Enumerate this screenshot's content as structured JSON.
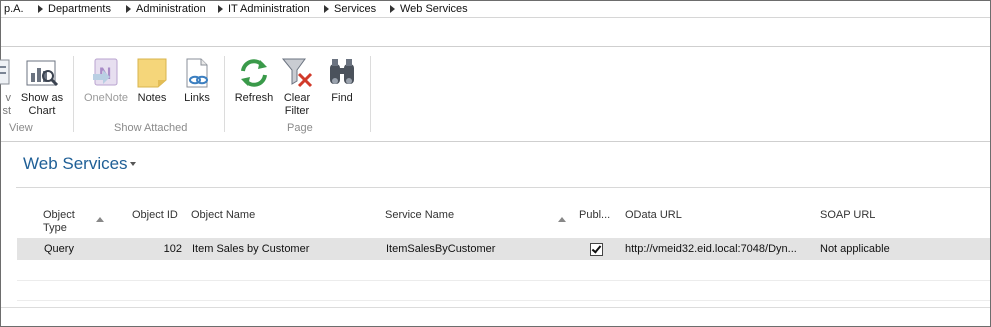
{
  "breadcrumb": {
    "items": [
      "p.A.",
      "Departments",
      "Administration",
      "IT Administration",
      "Services",
      "Web Services"
    ]
  },
  "ribbon": {
    "view_group": {
      "partial_label": "v\nst",
      "chart_label": "Show as\nChart",
      "group_label": "View"
    },
    "attached_group": {
      "onenote_label": "OneNote",
      "notes_label": "Notes",
      "links_label": "Links",
      "group_label": "Show Attached"
    },
    "page_group": {
      "refresh_label": "Refresh",
      "clear_filter_label": "Clear\nFilter",
      "find_label": "Find",
      "group_label": "Page"
    }
  },
  "page": {
    "title": "Web Services"
  },
  "table": {
    "columns": {
      "object_type": "Object\nType",
      "object_id": "Object ID",
      "object_name": "Object Name",
      "service_name": "Service Name",
      "published": "Publ...",
      "odata_url": "OData URL",
      "soap_url": "SOAP URL"
    },
    "rows": [
      {
        "object_type": "Query",
        "object_id": "102",
        "object_name": "Item Sales by Customer",
        "service_name": "ItemSalesByCustomer",
        "published": true,
        "odata_url": "http://vmeid32.eid.local:7048/Dyn...",
        "soap_url": "Not applicable"
      }
    ]
  },
  "colors": {
    "title": "#1f5f96",
    "row_highlight": "#e3e3e3",
    "refresh_green": "#3a9a4a",
    "clear_filter_red": "#d13a2a"
  },
  "icons": [
    "list-icon",
    "chart-icon",
    "onenote-icon",
    "notes-icon",
    "links-icon",
    "refresh-icon",
    "clear-filter-icon",
    "find-icon"
  ]
}
